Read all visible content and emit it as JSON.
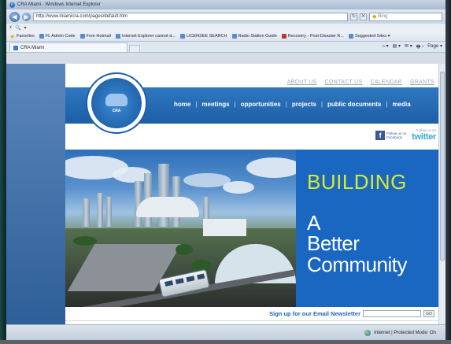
{
  "window": {
    "title": "CRA Miami - Windows Internet Explorer"
  },
  "address_bar": {
    "url": "http://www.miamicra.com/pages/default.htm",
    "search_placeholder": "Bing"
  },
  "menu": {
    "items": [
      "x",
      "🔍",
      "▾"
    ]
  },
  "favorites_bar": {
    "label": "Favorites",
    "items": [
      "FL Admin Code",
      "Free Hotmail",
      "Internet Explorer cannot d...",
      "LICENSEE SEARCH",
      "Radio Station Guide",
      "Recovery - Post-Disaster R...",
      "Suggested Sites ▾"
    ]
  },
  "tabs": [
    {
      "label": "CRA Miami"
    }
  ],
  "command_bar": {
    "items": [
      "⌂ ▾",
      "▤ ▾",
      "✉ ▾",
      "🖶 ▾",
      "Page ▾"
    ]
  },
  "site": {
    "top_links": [
      "ABOUT US",
      "CONTACT US",
      "CALENDAR",
      "GRANTS"
    ],
    "logo": {
      "ring_text": "MIAMI COMMUNITY REDEVELOPMENT AGENCY",
      "abbr": "CRA"
    },
    "nav": [
      "home",
      "meetings",
      "opportunities",
      "projects",
      "public documents",
      "media"
    ],
    "social": {
      "facebook_text": "Follow us on Facebook",
      "twitter_small": "Follow us on",
      "twitter_big": "twitter"
    },
    "hero": {
      "headline": "BUILDING",
      "line1": "A",
      "line2": "Better",
      "line3": "Community"
    },
    "newsletter": {
      "label": "Sign up for our Email Newsletter",
      "button": "GO"
    }
  },
  "status_bar": {
    "zone": "Internet | Protected Mode: On"
  },
  "colors": {
    "nav_blue": "#1d5ea6",
    "panel_blue": "#1a67c2",
    "headline_yellow": "#d7ea2e"
  }
}
